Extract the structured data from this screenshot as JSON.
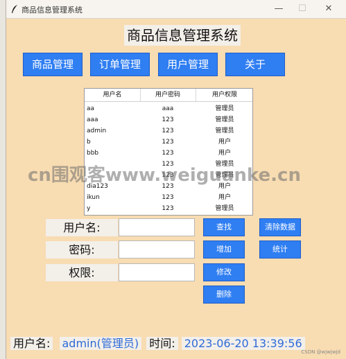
{
  "window": {
    "title": "商品信息管理系统",
    "minimize": "—",
    "maximize": "☐",
    "close": "✕"
  },
  "app": {
    "heading": "商品信息管理系统"
  },
  "nav": {
    "goods": "商品管理",
    "orders": "订单管理",
    "users": "用户管理",
    "about": "关于"
  },
  "table": {
    "headers": [
      "用户名",
      "用户密码",
      "用户权限"
    ],
    "rows": [
      [
        "aa",
        "aaa",
        "管理员"
      ],
      [
        "aaa",
        "123",
        "管理员"
      ],
      [
        "admin",
        "123",
        "管理员"
      ],
      [
        "b",
        "123",
        "用户"
      ],
      [
        "bbb",
        "123",
        "用户"
      ],
      [
        "",
        "123",
        "管理员"
      ],
      [
        "",
        "123",
        "管理员"
      ],
      [
        "dia123",
        "123",
        "用户"
      ],
      [
        "ikun",
        "123",
        "用户"
      ],
      [
        "y",
        "123",
        "管理员"
      ]
    ]
  },
  "form": {
    "username_label": "用户名:",
    "password_label": "密码:",
    "permission_label": "权限:",
    "username_value": "",
    "password_value": "",
    "permission_value": ""
  },
  "actions": {
    "search": "查找",
    "add": "增加",
    "modify": "修改",
    "delete": "删除",
    "clear": "清除数据",
    "stats": "统计"
  },
  "status": {
    "user_label": "用户名:",
    "user_value": "admin(管理员)",
    "time_label": "时间:",
    "time_value": "2023-06-20 13:39:56"
  },
  "overlay": {
    "watermark": "cn围观客www.weiguanke.cn",
    "credit": "CSDN @wjwjwjd"
  }
}
